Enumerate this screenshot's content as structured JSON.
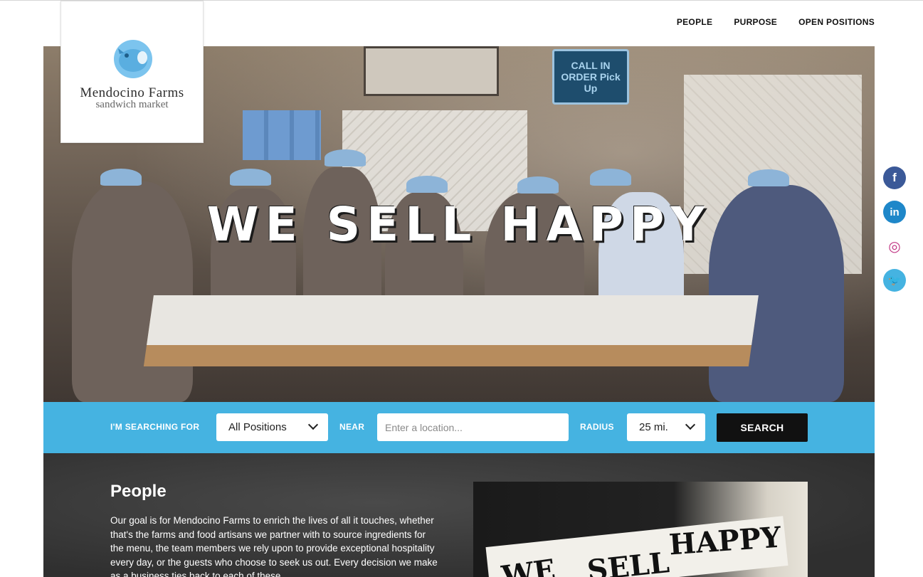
{
  "brand": {
    "name": "Mendocino Farms",
    "tagline": "sandwich market"
  },
  "nav": {
    "items": [
      "PEOPLE",
      "PURPOSE",
      "OPEN POSITIONS"
    ]
  },
  "hero": {
    "headline": "WE SELL HAPPY",
    "sign_text": "CALL IN ORDER Pick Up"
  },
  "social": [
    {
      "icon": "facebook-icon",
      "glyph": "f",
      "color": "#3b5998"
    },
    {
      "icon": "linkedin-icon",
      "glyph": "in",
      "color": "#1e87c9"
    },
    {
      "icon": "instagram-icon",
      "glyph": "◎",
      "color": "#ffffff"
    },
    {
      "icon": "twitter-icon",
      "glyph": "🐦",
      "color": "#45b3e1"
    }
  ],
  "search": {
    "searching_label": "I'M SEARCHING FOR",
    "position_value": "All Positions",
    "near_label": "NEAR",
    "location_placeholder": "Enter a location...",
    "radius_label": "RADIUS",
    "radius_value": "25 mi.",
    "button_label": "SEARCH"
  },
  "people": {
    "heading": "People",
    "body": "Our goal is for Mendocino Farms to enrich the lives of all it touches, whether that's the farms and food artisans we partner with to source ingredients for the menu, the team members we rely upon to provide exceptional hospitality every day, or the guests who choose to seek us out. Every decision we make as a business ties back to each of these",
    "photo_words": [
      "WE",
      "SELL",
      "HAPPY"
    ]
  },
  "colors": {
    "accent": "#45b3e1",
    "dark": "#111111",
    "panel": "#3a3a3a"
  }
}
